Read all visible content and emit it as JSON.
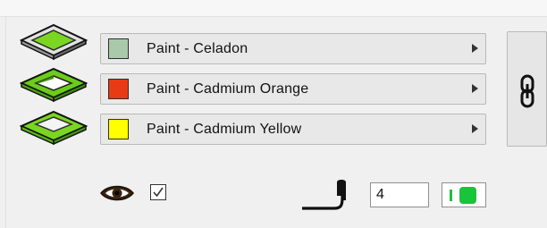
{
  "layers": [
    {
      "icon": "face-flat-icon",
      "swatch_color": "#a9c9aa",
      "label": "Paint - Celadon"
    },
    {
      "icon": "face-inset-icon",
      "swatch_color": "#e83a14",
      "label": "Paint - Cadmium Orange"
    },
    {
      "icon": "face-bevel-icon",
      "swatch_color": "#ffff00",
      "label": "Paint - Cadmium Yellow"
    }
  ],
  "colors": {
    "accent_green": "#76d41e",
    "toggle_green": "#18c43a"
  },
  "link_icon": "chain-link-icon",
  "visibility": {
    "icon": "eye-icon",
    "checked": true
  },
  "line": {
    "icon": "line-weight-icon",
    "width_value": "4"
  }
}
